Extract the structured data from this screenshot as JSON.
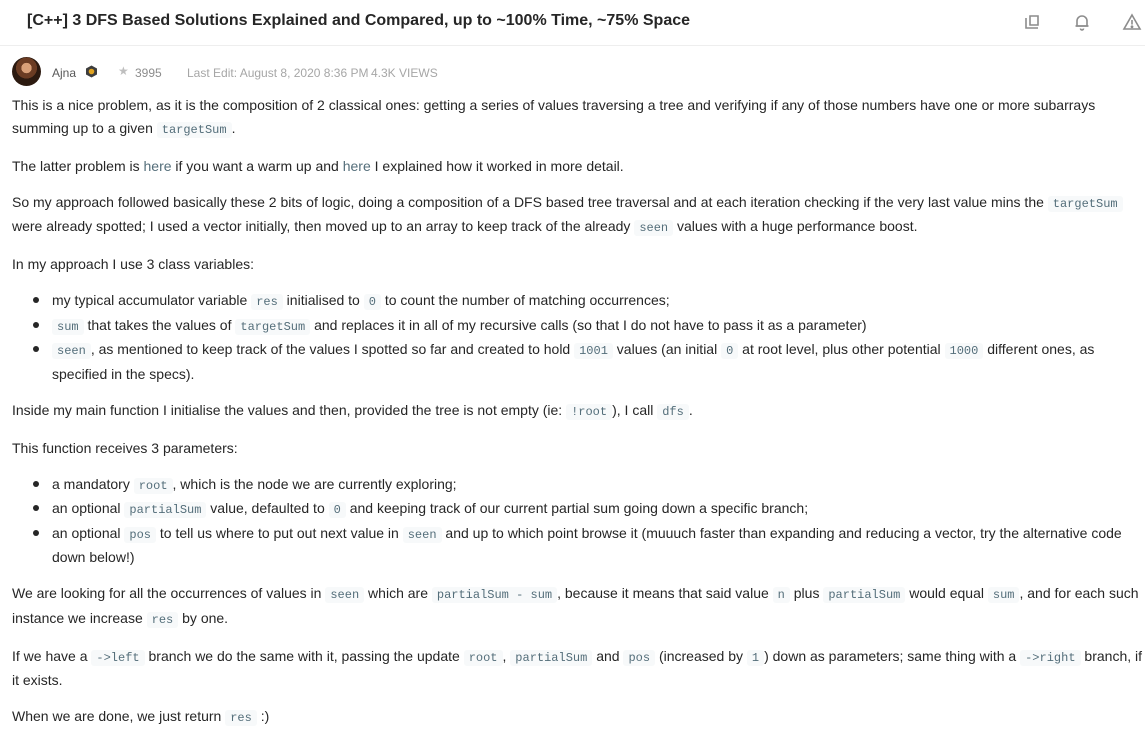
{
  "header": {
    "title": "[C++] 3 DFS Based Solutions Explained and Compared, up to ~100% Time, ~75% Space",
    "icons": [
      "share-icon",
      "bell-icon",
      "warning-icon"
    ]
  },
  "meta": {
    "author": "Ajna",
    "reputation": "3995",
    "last_edit": "Last Edit: August 8, 2020 8:36 PM",
    "views": "4.3K VIEWS"
  },
  "post": {
    "p1": {
      "t1": "This is a nice problem, as it is the composition of 2 classical ones: getting a series of values traversing a tree and verifying if any of those numbers have one or more subarrays summing up to a given ",
      "c1": "targetSum",
      "t2": "."
    },
    "p2": {
      "t1": "The latter problem is ",
      "link1": "here",
      "t2": " if you want a warm up and ",
      "link2": "here",
      "t3": " I explained how it worked in more detail."
    },
    "p3": {
      "t1": "So my approach followed basically these 2 bits of logic, doing a composition of a DFS based tree traversal and at each iteration checking if the very last value mins the ",
      "c1": "targetSum",
      "t2": " were already spotted; I used a vector initially, then moved up to an array to keep track of the already ",
      "c2": "seen",
      "t3": " values with a huge performance boost."
    },
    "p4": "In my approach I use 3 class variables:",
    "list1": {
      "i1": {
        "t1": "my typical accumulator variable ",
        "c1": "res",
        "t2": " initialised to ",
        "c2": "0",
        "t3": " to count the number of matching occurrences;"
      },
      "i2": {
        "c1": "sum",
        "t1": " that takes the values of ",
        "c2": "targetSum",
        "t2": " and replaces it in all of my recursive calls (so that I do not have to pass it as a parameter)"
      },
      "i3": {
        "c1": "seen",
        "t1": ", as mentioned to keep track of the values I spotted so far and created to hold ",
        "c2": "1001",
        "t2": " values (an initial ",
        "c3": "0",
        "t3": " at root level, plus other potential ",
        "c4": "1000",
        "t4": " different ones, as specified in the specs)."
      }
    },
    "p5": {
      "t1": "Inside my main function I initialise the values and then, provided the tree is not empty (ie: ",
      "c1": "!root",
      "t2": "), I call ",
      "c2": "dfs",
      "t3": "."
    },
    "p6": "This function receives 3 parameters:",
    "list2": {
      "i1": {
        "t1": "a mandatory ",
        "c1": "root",
        "t2": ", which is the node we are currently exploring;"
      },
      "i2": {
        "t1": "an optional ",
        "c1": "partialSum",
        "t2": " value, defaulted to ",
        "c2": "0",
        "t3": " and keeping track of our current partial sum going down a specific branch;"
      },
      "i3": {
        "t1": "an optional ",
        "c1": "pos",
        "t2": " to tell us where to put out next value in ",
        "c2": "seen",
        "t3": " and up to which point browse it (muuuch faster than expanding and reducing a vector, try the alternative code down below!)"
      }
    },
    "p7": {
      "t1": "We are looking for all the occurrences of values in ",
      "c1": "seen",
      "t2": " which are ",
      "c2": "partialSum - sum",
      "t3": ", because it means that said value ",
      "c3": "n",
      "t4": " plus ",
      "c4": "partialSum",
      "t5": " would equal ",
      "c5": "sum",
      "t6": ", and for each such instance we increase ",
      "c6": "res",
      "t7": " by one."
    },
    "p8": {
      "t1": "If we have a ",
      "c1": "->left",
      "t2": " branch we do the same with it, passing the update ",
      "c2": "root",
      "t3": ", ",
      "c3": "partialSum",
      "t4": " and ",
      "c4": "pos",
      "t5": " (increased by ",
      "c5": "1",
      "t6": ") down as parameters; same thing with a ",
      "c6": "->right",
      "t7": " branch, if it exists."
    },
    "p9": {
      "t1": "When we are done, we just return ",
      "c1": "res",
      "t2": " :)"
    }
  },
  "colors": {
    "text": "#262626",
    "code_text": "#546e7a",
    "code_bg": "#f7f9fa",
    "meta_text": "#a6a6a6"
  }
}
